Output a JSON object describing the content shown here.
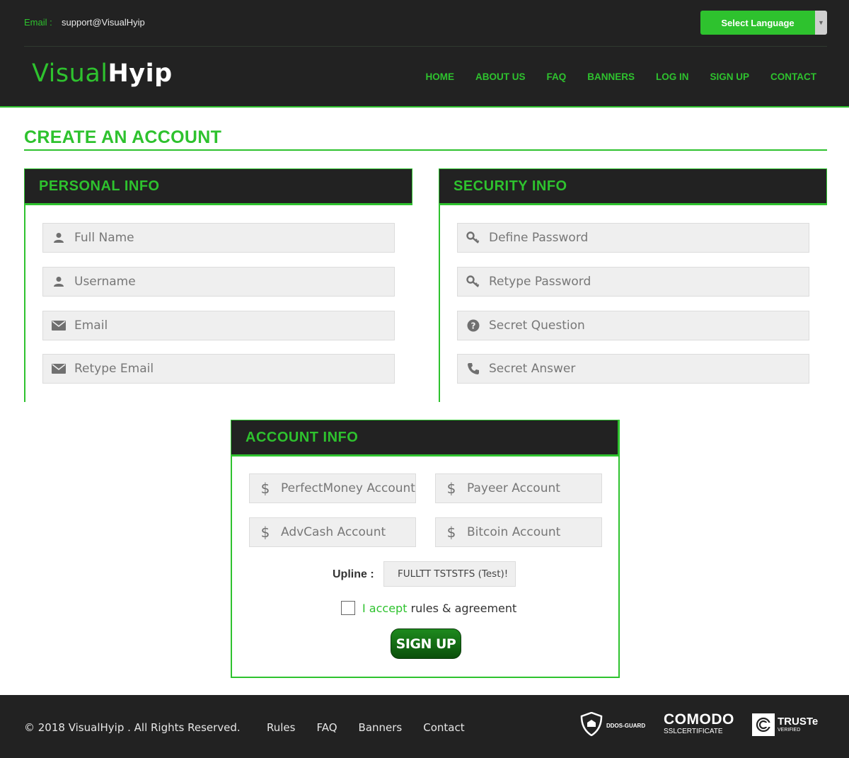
{
  "header": {
    "email_label": "Email :",
    "email_value": "support@VisualHyip",
    "language_button": "Select Language",
    "logo_part1": "Visual",
    "logo_part2": "Hyip",
    "nav": [
      "HOME",
      "ABOUT US",
      "FAQ",
      "BANNERS",
      "LOG IN",
      "SIGN UP",
      "CONTACT"
    ]
  },
  "page_title": "CREATE AN ACCOUNT",
  "personal": {
    "title": "PERSONAL INFO",
    "fields": [
      {
        "placeholder": "Full Name",
        "icon": "user-icon"
      },
      {
        "placeholder": "Username",
        "icon": "user-icon"
      },
      {
        "placeholder": "Email",
        "icon": "envelope-icon"
      },
      {
        "placeholder": "Retype Email",
        "icon": "envelope-icon"
      }
    ]
  },
  "security": {
    "title": "SECURITY INFO",
    "fields": [
      {
        "placeholder": "Define Password",
        "icon": "key-icon"
      },
      {
        "placeholder": "Retype Password",
        "icon": "key-icon"
      },
      {
        "placeholder": "Secret Question",
        "icon": "question-circle-icon"
      },
      {
        "placeholder": "Secret Answer",
        "icon": "phone-icon"
      }
    ]
  },
  "account": {
    "title": "ACCOUNT INFO",
    "fields": [
      {
        "placeholder": "PerfectMoney Account",
        "icon": "dollar-icon"
      },
      {
        "placeholder": "Payeer Account",
        "icon": "dollar-icon"
      },
      {
        "placeholder": "AdvCash Account",
        "icon": "dollar-icon"
      },
      {
        "placeholder": "Bitcoin Account",
        "icon": "dollar-icon"
      }
    ],
    "upline_label": "Upline :",
    "upline_value": "FULLTT TSTSTFS (Test)!",
    "accept_prefix": "I accept",
    "accept_suffix": " rules & agreement",
    "signup_button": "SIGN UP"
  },
  "footer": {
    "copyright": "© 2018 VisualHyip . All Rights Reserved.",
    "links": [
      "Rules",
      "FAQ",
      "Banners",
      "Contact"
    ],
    "badge_ddos": "DDOS-GUARD",
    "badge_comodo": "COMODO",
    "badge_comodo_sub": "SSLCERTIFICATE",
    "badge_truste": "TRUSTe",
    "badge_truste_sub": "VERIFIED"
  },
  "colors": {
    "accent": "#2ec22e",
    "dark": "#222222",
    "field_bg": "#efefef"
  }
}
